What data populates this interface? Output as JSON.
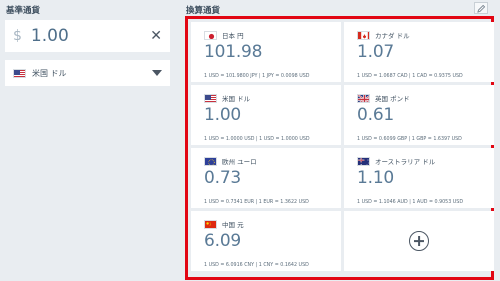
{
  "base": {
    "section_label": "基準通貨",
    "currency_symbol": "$",
    "amount": "1.00",
    "clear_glyph": "✕",
    "selected_currency": "米国 ドル"
  },
  "converted": {
    "section_label": "換算通貨",
    "cards": [
      {
        "flag": "jp-flag",
        "name": "日本 円",
        "value": "101.98",
        "rate": "1 USD = 101.9800 JPY | 1 JPY = 0.0098 USD"
      },
      {
        "flag": "ca-flag",
        "name": "カナダ ドル",
        "value": "1.07",
        "rate": "1 USD = 1.0687 CAD | 1 CAD = 0.9375 USD"
      },
      {
        "flag": "us-flag",
        "name": "米国 ドル",
        "value": "1.00",
        "rate": "1 USD = 1.0000 USD | 1 USD = 1.0000 USD"
      },
      {
        "flag": "gb-flag",
        "name": "英国 ポンド",
        "value": "0.61",
        "rate": "1 USD = 0.6099 GBP | 1 GBP = 1.6397 USD"
      },
      {
        "flag": "eu-flag",
        "name": "欧州 ユーロ",
        "value": "0.73",
        "rate": "1 USD = 0.7341 EUR | 1 EUR = 1.3622 USD"
      },
      {
        "flag": "au-flag",
        "name": "オーストラリア ドル",
        "value": "1.10",
        "rate": "1 USD = 1.1046 AUD | 1 AUD = 0.9053 USD"
      },
      {
        "flag": "cn-flag",
        "name": "中国 元",
        "value": "6.09",
        "rate": "1 USD = 6.0916 CNY | 1 CNY = 0.1642 USD"
      }
    ]
  },
  "colors": {
    "background": "#e9edf1",
    "highlight_border": "#e20613",
    "value_text": "#5a7a96"
  }
}
